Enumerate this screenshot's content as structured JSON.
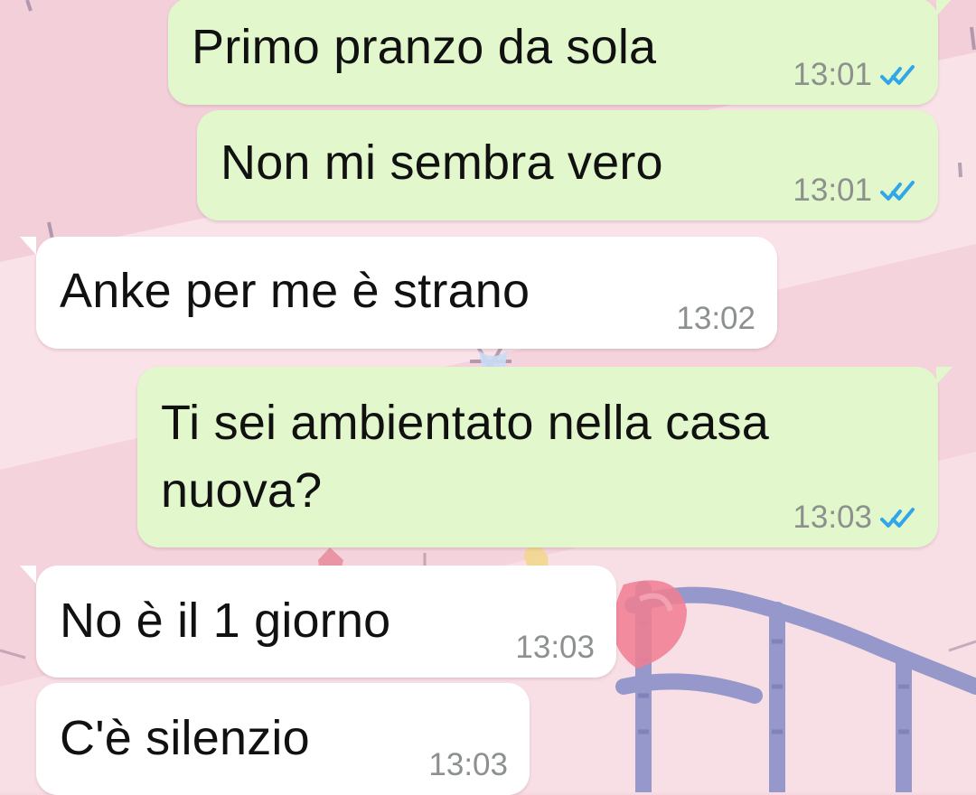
{
  "chat": {
    "messages": [
      {
        "direction": "outgoing",
        "lines": [
          "Primo pranzo da sola"
        ],
        "time": "13:01",
        "status": "read",
        "status_icon": "double-check-icon",
        "status_color": "#31a6e8"
      },
      {
        "direction": "outgoing",
        "lines": [
          "Non mi sembra vero"
        ],
        "time": "13:01",
        "status": "read",
        "status_icon": "double-check-icon",
        "status_color": "#31a6e8"
      },
      {
        "direction": "incoming",
        "lines": [
          "Anke per me è strano"
        ],
        "time": "13:02"
      },
      {
        "direction": "outgoing",
        "lines": [
          "Ti sei ambientato nella casa",
          "nuova?"
        ],
        "time": "13:03",
        "status": "read",
        "status_icon": "double-check-icon",
        "status_color": "#31a6e8"
      },
      {
        "direction": "incoming",
        "lines": [
          "No è il 1 giorno"
        ],
        "time": "13:03"
      },
      {
        "direction": "incoming",
        "lines": [
          "C'è silenzio"
        ],
        "time": "13:03"
      }
    ]
  },
  "colors": {
    "outgoing_bubble": "#e2f8cc",
    "incoming_bubble": "#ffffff",
    "timestamp": "#8d918d",
    "wallpaper": "#f7dbe2"
  }
}
